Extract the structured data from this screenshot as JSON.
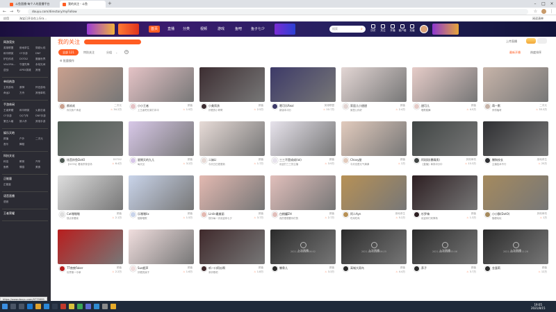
{
  "browser": {
    "tabs": [
      {
        "label": "斗鱼直播-每个人的直播平台"
      },
      {
        "label": "我的关注 - 斗鱼"
      }
    ],
    "url": "douyu.com/directory/myFollow",
    "bookmarks": [
      {
        "label": "应用"
      },
      {
        "label": "淘宝已开业在上Gra..."
      }
    ],
    "reading_list": "阅读清单"
  },
  "site_nav": {
    "items": [
      {
        "label": "首页"
      },
      {
        "label": "直播"
      },
      {
        "label": "分类"
      },
      {
        "label": "视频"
      },
      {
        "label": "游戏"
      },
      {
        "label": "鱼吧"
      },
      {
        "label": "鱼子七少"
      }
    ],
    "search_placeholder": "搜索",
    "icons": [
      {
        "label": "历史"
      },
      {
        "label": "关注"
      },
      {
        "label": "开播"
      },
      {
        "label": "客户端"
      },
      {
        "label": "充值"
      }
    ]
  },
  "sidebar": {
    "sections": [
      {
        "title": "网游竞技",
        "items": [
          "英雄联盟",
          "绝地求生",
          "穿越火线",
          "和平精英",
          "CF手游",
          "DNF",
          "炉石传说",
          "DOTA2",
          "魔兽世界",
          "VALORA...",
          "守望先锋",
          "永劫无间",
          "逆战",
          "APEX英雄",
          "其他"
        ]
      },
      {
        "title": "单机热游",
        "items": [
          "主机游戏",
          "原神",
          "怀旧游戏",
          "命运2",
          "方舟",
          "其他单机"
        ]
      },
      {
        "title": "手游休闲",
        "items": [
          "王者荣耀",
          "和平精英",
          "火影忍者",
          "CF手游",
          "QQ飞车",
          "DNF手游",
          "第五人格",
          "狼人杀",
          "其他手游"
        ]
      },
      {
        "title": "娱乐天地",
        "items": [
          "颜值",
          "户外",
          "二次元",
          "音乐",
          "舞蹈"
        ]
      },
      {
        "title": "科技文化",
        "items": [
          "科技",
          "教育",
          "汽车",
          "鱼教",
          "情感",
          "美食"
        ]
      },
      {
        "title": "正能量",
        "items": [
          "正能量"
        ]
      },
      {
        "title": "语音直播",
        "items": [
          "语音"
        ]
      },
      {
        "title": "王者荣耀",
        "items": []
      }
    ]
  },
  "main": {
    "page_title": "我的关注",
    "upload_label": "上传直播",
    "tabs": [
      {
        "label": "全部 121"
      },
      {
        "label": "特别关注"
      },
      {
        "label": "分组"
      }
    ],
    "manage_label": "批量操作",
    "right_actions": [
      {
        "label": "最新开播"
      },
      {
        "label": "热度排序"
      }
    ],
    "offline_label": "上次直播",
    "cards": [
      {
        "name": "颜欢欢",
        "category": "二次元",
        "title": "你欠我个承诺",
        "hot": "34.2万",
        "thumb": "#c9a08e"
      },
      {
        "name": "小小王者",
        "category": "颜值",
        "title": "上王者吧兄弟们冲冲",
        "hot": "1.9万",
        "thumb": "#e5c3c6"
      },
      {
        "name": "小美男孩",
        "category": "颜值",
        "title": "好看的小哥哥",
        "hot": "2.5万",
        "thumb": "#3d2e32"
      },
      {
        "name": "嗯可乐Real",
        "category": "英雄联盟",
        "title": "新版本冲分",
        "hot": "10.7万",
        "thumb": "#3d3a68"
      },
      {
        "name": "家居儿小甜甜",
        "category": "颜值",
        "title": "家居儿你好",
        "hot": "2.4万",
        "thumb": "#e3d6d4"
      },
      {
        "name": "甜可儿",
        "category": "颜值",
        "title": "唱歌跳舞",
        "hot": "4.5万",
        "thumb": "#e6ccc8"
      },
      {
        "name": "萌一默",
        "category": "二次元",
        "title": "来唠嗑呀",
        "hot": "33.3万",
        "thumb": "#c7b4a9"
      },
      {
        "name": "炫音炸鱼DotO",
        "category": "DOTA2",
        "title": "【DOTA】看我杀穿全场",
        "hot": "6.4万",
        "thumb": "#4f5a53"
      },
      {
        "name": "星期天的九儿",
        "category": "颜值",
        "title": "每天见",
        "hot": "3.2万",
        "thumb": "#d8c8e8"
      },
      {
        "name": "二妹Ll",
        "category": "颜值",
        "title": "今天日日更更新",
        "hot": "1.7万",
        "thumb": "#e7dbd7"
      },
      {
        "name": "三三不是成成(lol)",
        "category": "颜值",
        "title": "欢迎打三三的主播",
        "hot": "3.9万",
        "thumb": "#e7e3ec"
      },
      {
        "name": "Chovy甜",
        "category": "颜值",
        "title": "今天也是元气满满",
        "hot": "2万",
        "thumb": "#e2cbbd"
      },
      {
        "name": "阿斑斑(暴躁男)",
        "category": "其他单机",
        "title": "【直播】单排冲分中",
        "hot": "13.3万",
        "thumb": "#404544"
      },
      {
        "name": "懒狗校长",
        "category": "绝地求生",
        "title": "主播技术不行",
        "hot": "25万",
        "thumb": "#2f3033"
      },
      {
        "name": "Cat嘿嘿嘿",
        "category": "颜值",
        "title": "快点来看我",
        "hot": "2.1万",
        "thumb": "#dedede"
      },
      {
        "name": "乐嘿嘿lix",
        "category": "颜值",
        "title": "陪聊唱歌",
        "hot": "1.5万",
        "thumb": "#c9d4ea"
      },
      {
        "name": "Linlin最美丽",
        "category": "颜值",
        "title": "快乐每一天欢迎你七夕",
        "hot": "3.7万",
        "thumb": "#e3b9b1"
      },
      {
        "name": "白桃罐ZH",
        "category": "颜值",
        "title": "真的很想要你们的",
        "hot": "2.7万",
        "thumb": "#e1bfbb"
      },
      {
        "name": "阿二Ayn",
        "category": "绝地求生",
        "title": "吃鸡吃鸡",
        "hot": "5.2万",
        "thumb": "#b79156"
      },
      {
        "name": "杉罗嗨",
        "category": "颜值",
        "title": "欢迎你们来捧场",
        "hot": "1.3万",
        "thumb": "#2d1f22"
      },
      {
        "name": "小小酥(DotO)",
        "category": "其他单机",
        "title": "随便玩玩",
        "hot": "1万",
        "thumb": "#a58a5e"
      },
      {
        "name": "TT夜夜Faker",
        "category": "颜值",
        "title": "世界第一中单",
        "hot": "2.2万",
        "thumb": "#b81e1e"
      },
      {
        "name": "Sue超声",
        "category": "颜值",
        "title": "好看的妹子",
        "hot": "1.6万",
        "thumb": "#f0dede"
      },
      {
        "name": "听一口阿瓜啊",
        "category": "颜值",
        "title": "来听歌吧",
        "hot": "1.8万",
        "thumb": "#402a2c"
      },
      {
        "name": "懒骨儿",
        "category": "颜值",
        "title": "",
        "hot": "3.3万",
        "thumb": "#2b2b2b",
        "offline": true,
        "date": "2021-07-25 17:06:02"
      },
      {
        "name": "高城大雨鸟",
        "category": "颜值",
        "title": "",
        "hot": "4.4万",
        "thumb": "#2b2b2b",
        "offline": true,
        "date": "2021-08-11 22:06:25"
      },
      {
        "name": "养子",
        "category": "颜值",
        "title": "",
        "hot": "3.7万",
        "thumb": "#2b2b2b",
        "offline": true,
        "date": "2021-08-15 15:55:06"
      },
      {
        "name": "金蛋莉",
        "category": "颜值",
        "title": "",
        "hot": "12万",
        "thumb": "#2b2b2b",
        "offline": true,
        "date": "2021-08-15 13:11:26"
      }
    ]
  },
  "status_url": "https://www.douyu.com/9779999",
  "clock": {
    "time": "19:05",
    "date": "2021/8/15"
  },
  "colors": {
    "accent": "#ff5d23",
    "sidebar": "#2b2b33",
    "taskbar": "#1f2a3a"
  }
}
